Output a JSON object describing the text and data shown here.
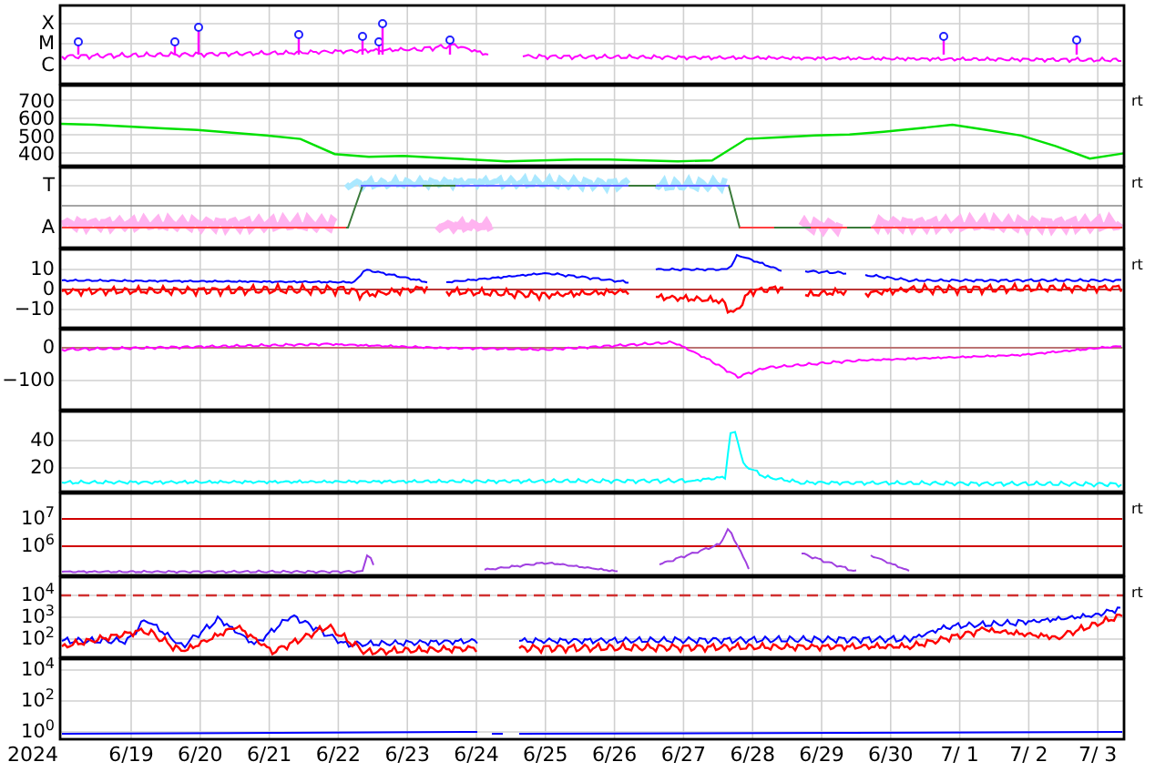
{
  "year": "2024",
  "dates": [
    "6/19",
    "6/20",
    "6/21",
    "6/22",
    "6/23",
    "6/24",
    "6/25",
    "6/26",
    "6/27",
    "6/28",
    "6/29",
    "6/30",
    "7/ 1",
    "7/ 2",
    "7/ 3"
  ],
  "panels": [
    {
      "ticks": [
        "X",
        "M",
        "C"
      ]
    },
    {
      "side_label": "rt",
      "chart_data": {
        "type": "line",
        "ylim": [
          330,
          780
        ],
        "yticks": [
          {
            "value": 700,
            "label": "700"
          },
          {
            "value": 600,
            "label": "600"
          },
          {
            "value": 500,
            "label": "500"
          },
          {
            "value": 400,
            "label": "400"
          }
        ],
        "categories": [
          null,
          null,
          null,
          null,
          null,
          null,
          null,
          null,
          null,
          null,
          null,
          null,
          null,
          null,
          null,
          null,
          null,
          null,
          null,
          null,
          null,
          null,
          null,
          null,
          null,
          null,
          null,
          null,
          null,
          null,
          null,
          null
        ],
        "series": [
          {
            "color": "#00e000",
            "values": [
              565,
              560,
              550,
              540,
              530,
              515,
              500,
              480,
              395,
              380,
              385,
              375,
              365,
              355,
              360,
              365,
              365,
              360,
              355,
              360,
              480,
              490,
              500,
              505,
              520,
              540,
              560,
              530,
              500,
              440,
              370,
              400
            ]
          }
        ]
      }
    },
    {
      "ticks": [
        "T",
        "A"
      ],
      "side_label": "rt"
    },
    {
      "ticks": [
        "10",
        "0",
        "−10"
      ],
      "side_label": "rt"
    },
    {
      "ticks": [
        "0",
        "−100"
      ]
    },
    {
      "ticks": [
        "40",
        "20"
      ]
    },
    {
      "ticks": [
        "10$^{7}$",
        "10$^{6}$"
      ],
      "side_label": "rt"
    },
    {
      "ticks": [
        "10$^{4}$",
        "10$^{3}$",
        "10$^{2}$"
      ],
      "side_label": "rt"
    },
    {
      "ticks": [
        "10$^{4}$",
        "10$^{2}$",
        "10$^{0}$"
      ]
    }
  ]
}
